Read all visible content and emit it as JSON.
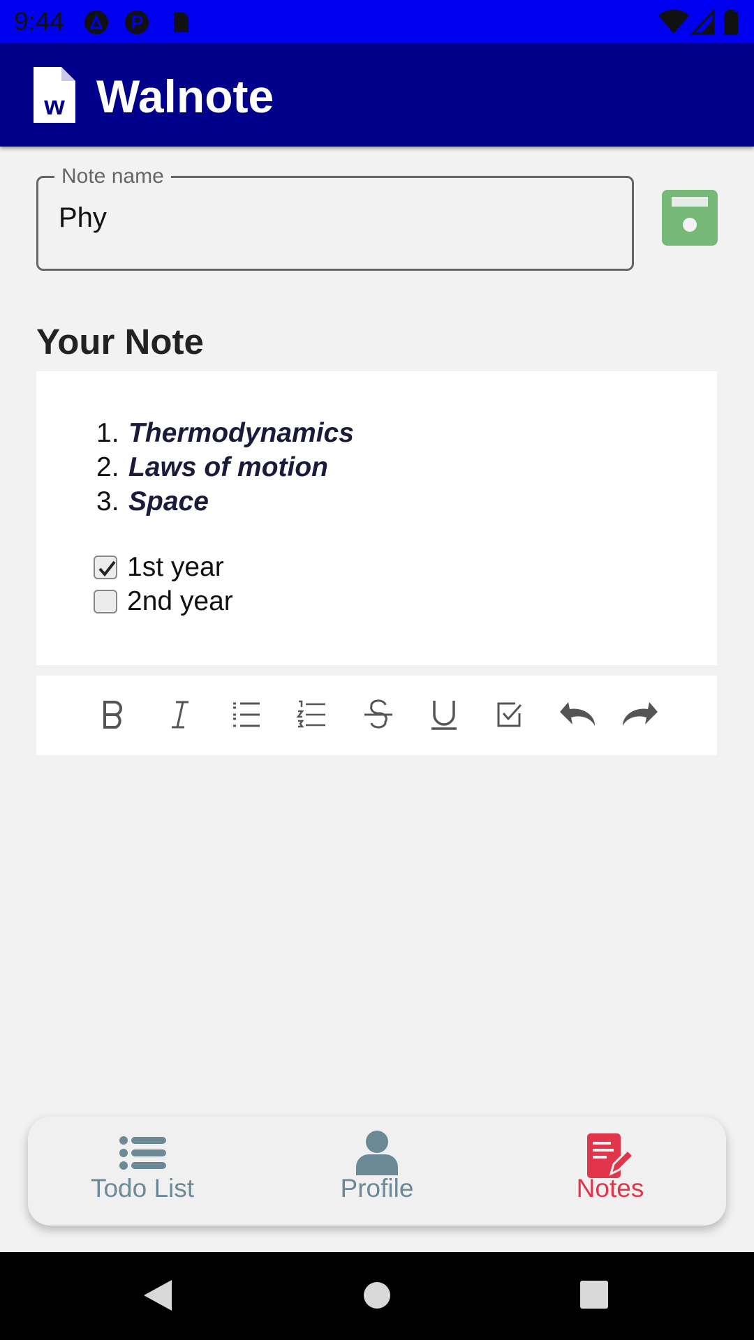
{
  "status_bar": {
    "time": "9:44"
  },
  "app_bar": {
    "logo_letter": "w",
    "title": "Walnote"
  },
  "note_field": {
    "label": "Note name",
    "value": "Phy"
  },
  "section": {
    "title": "Your Note"
  },
  "editor": {
    "ordered_items": [
      {
        "num": "1.",
        "text": "Thermodynamics"
      },
      {
        "num": "2.",
        "text": "Laws of motion"
      },
      {
        "num": "3.",
        "text": "Space"
      }
    ],
    "checklist": [
      {
        "label": "1st year",
        "checked": true
      },
      {
        "label": "2nd year",
        "checked": false
      }
    ]
  },
  "toolbar": {
    "buttons": [
      "bold-icon",
      "italic-icon",
      "bullet-list-icon",
      "numbered-list-icon",
      "strikethrough-icon",
      "underline-icon",
      "checkbox-icon",
      "undo-icon",
      "redo-icon"
    ]
  },
  "bottom_nav": {
    "items": [
      {
        "label": "Todo List",
        "icon": "list-icon",
        "active": false
      },
      {
        "label": "Profile",
        "icon": "person-icon",
        "active": false
      },
      {
        "label": "Notes",
        "icon": "note-edit-icon",
        "active": true
      }
    ]
  },
  "colors": {
    "status_bar": "#0000f0",
    "app_bar": "#00008b",
    "save_button": "#76b878",
    "nav_inactive": "#6c8996",
    "nav_active": "#e0354b"
  }
}
